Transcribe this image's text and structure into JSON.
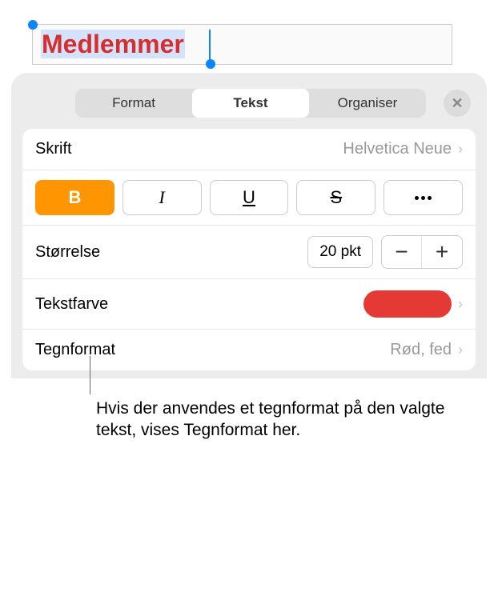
{
  "canvas": {
    "text": "Medlemmer"
  },
  "tabs": {
    "format": "Format",
    "tekst": "Tekst",
    "organiser": "Organiser"
  },
  "rows": {
    "skrift_label": "Skrift",
    "skrift_value": "Helvetica Neue",
    "storrelse_label": "Størrelse",
    "storrelse_value": "20 pkt",
    "tekstfarve_label": "Tekstfarve",
    "tegnformat_label": "Tegnformat",
    "tegnformat_value": "Rød, fed"
  },
  "style": {
    "bold": "B",
    "italic": "I",
    "underline": "U",
    "strike": "S"
  },
  "colors": {
    "text_color": "#e53935",
    "accent": "#ff9500"
  },
  "callout": "Hvis der anvendes et tegnformat på den valgte tekst, vises Tegnformat her."
}
